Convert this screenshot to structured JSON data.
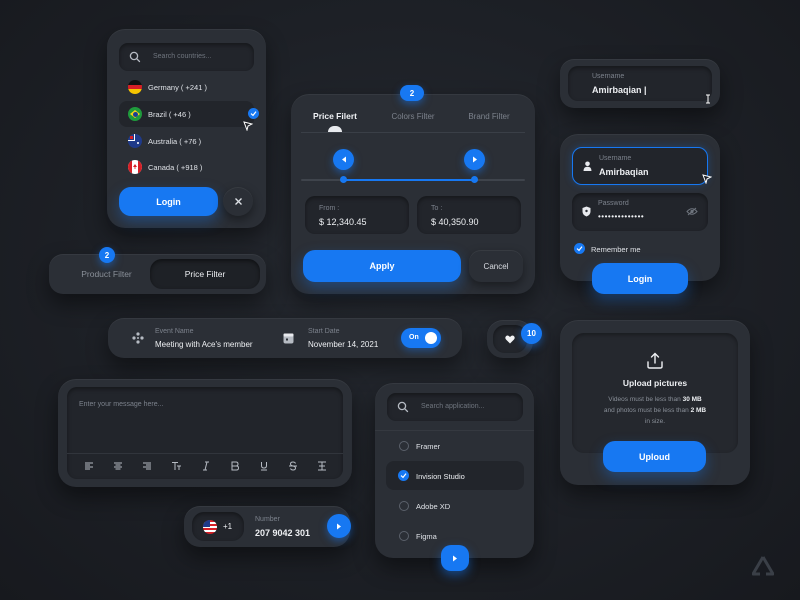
{
  "country_picker": {
    "search_placeholder": "Search countries...",
    "countries": [
      {
        "name": "Germany ( +241 )"
      },
      {
        "name": "Brazil ( +46 )"
      },
      {
        "name": "Australia ( +76 )"
      },
      {
        "name": "Canada ( +918 )"
      }
    ],
    "selected_index": 1,
    "login_label": "Login"
  },
  "filter_tabs": {
    "badge": "2",
    "tabs": [
      "Product Filter",
      "Price Filter"
    ],
    "active_index": 1
  },
  "price_filter": {
    "badge": "2",
    "tabs": [
      "Price Filert",
      "Colors Filter",
      "Brand Filter"
    ],
    "active_index": 0,
    "from_label": "From :",
    "from_value": "$ 12,340.45",
    "to_label": "To :",
    "to_value": "$ 40,350.90",
    "apply_label": "Apply",
    "cancel_label": "Cancel"
  },
  "username_field": {
    "label": "Username",
    "value": "Amirbaqian |"
  },
  "login_form": {
    "username_label": "Username",
    "username_value": "Amirbaqian",
    "password_label": "Password",
    "password_value": "••••••••••••••",
    "remember_label": "Remember me",
    "remember_checked": true,
    "login_label": "Login"
  },
  "event_bar": {
    "event_label": "Event Name",
    "event_value": "Meeting with Ace's member",
    "date_label": "Start Date",
    "date_value": "November 14, 2021",
    "toggle_label": "On",
    "toggle_on": true
  },
  "like_button": {
    "count": "10"
  },
  "upload": {
    "title": "Upload pictures",
    "line1_prefix": "Videos must be less than ",
    "line1_bold": "30 MB",
    "line2_prefix": "and photos must be less than ",
    "line2_bold": "2 MB",
    "line3": "in size.",
    "button_label": "Uploud"
  },
  "message_editor": {
    "placeholder": "Enter your message here...",
    "toolbar_icons": [
      "align-left-icon",
      "align-center-icon",
      "align-right-icon",
      "text-size-icon",
      "italic-icon",
      "bold-icon",
      "underline-icon",
      "strikethrough-icon",
      "text-cursor-icon"
    ]
  },
  "phone_input": {
    "code": "+1",
    "label": "Number",
    "value": "207 9042 301"
  },
  "app_picker": {
    "search_placeholder": "Search application...",
    "apps": [
      {
        "name": "Framer",
        "checked": false
      },
      {
        "name": "Invision Studio",
        "checked": true
      },
      {
        "name": "Adobe XD",
        "checked": false
      },
      {
        "name": "Figma",
        "checked": false
      }
    ]
  },
  "colors": {
    "accent": "#1778f2",
    "card": "#2b2f36",
    "inset": "#22252b",
    "background": "#1d2026"
  }
}
